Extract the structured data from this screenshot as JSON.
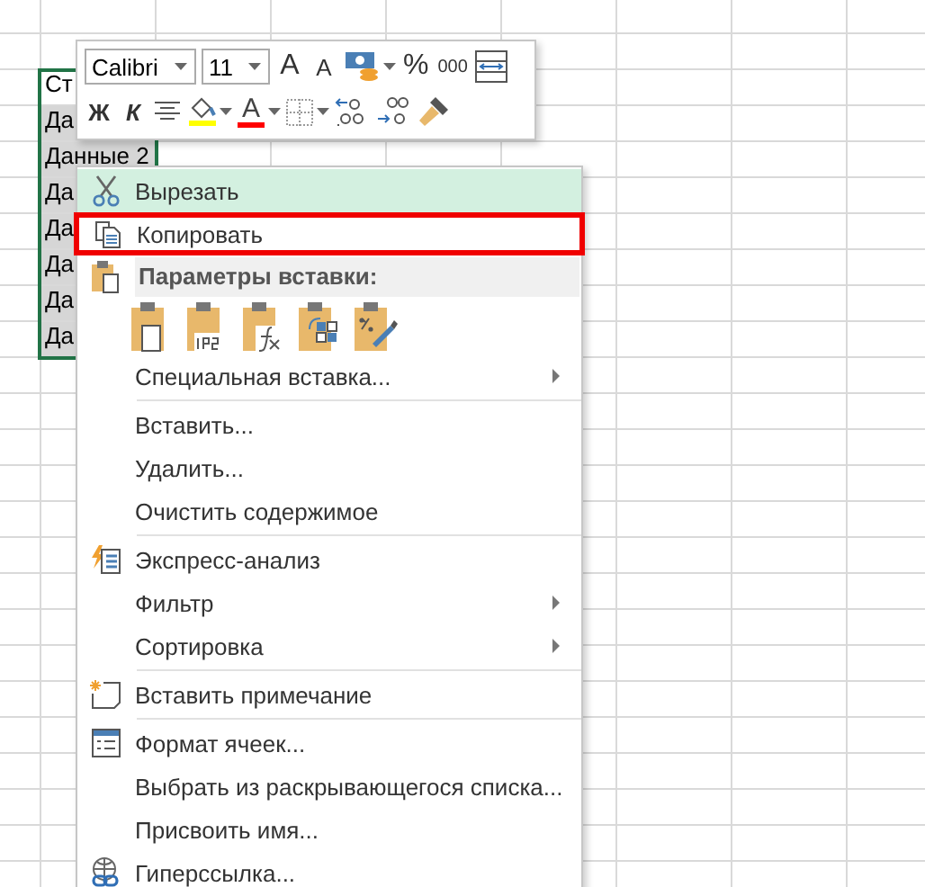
{
  "sheet": {
    "cells": [
      {
        "text": "Ст",
        "selected": false
      },
      {
        "text": "Да",
        "selected": true
      },
      {
        "text": "Данные 2",
        "selected": true
      },
      {
        "text": "Да",
        "selected": true
      },
      {
        "text": "Да",
        "selected": true
      },
      {
        "text": "Да",
        "selected": true
      },
      {
        "text": "Да",
        "selected": true
      },
      {
        "text": "Да",
        "selected": true
      }
    ]
  },
  "mini_toolbar": {
    "font": "Calibri",
    "size": "11",
    "grow_font": "A",
    "shrink_font": "A",
    "percent": "%",
    "thousands": "000",
    "bold": "Ж",
    "italic": "К",
    "font_color_label": "A"
  },
  "context_menu": {
    "items": [
      {
        "kind": "item",
        "label": "Вырезать",
        "highlighted": true,
        "outlined": false,
        "submenu": false
      },
      {
        "kind": "item",
        "label": "Копировать",
        "highlighted": false,
        "outlined": true,
        "submenu": false
      },
      {
        "kind": "header",
        "label": "Параметры вставки:"
      },
      {
        "kind": "paste_options"
      },
      {
        "kind": "item",
        "label": "Специальная вставка...",
        "highlighted": false,
        "outlined": false,
        "submenu": true
      },
      {
        "kind": "separator"
      },
      {
        "kind": "item",
        "label": "Вставить...",
        "highlighted": false,
        "outlined": false,
        "submenu": false
      },
      {
        "kind": "item",
        "label": "Удалить...",
        "highlighted": false,
        "outlined": false,
        "submenu": false
      },
      {
        "kind": "item",
        "label": "Очистить содержимое",
        "highlighted": false,
        "outlined": false,
        "submenu": false
      },
      {
        "kind": "separator"
      },
      {
        "kind": "item",
        "label": "Экспресс-анализ",
        "highlighted": false,
        "outlined": false,
        "submenu": false
      },
      {
        "kind": "item",
        "label": "Фильтр",
        "highlighted": false,
        "outlined": false,
        "submenu": true
      },
      {
        "kind": "item",
        "label": "Сортировка",
        "highlighted": false,
        "outlined": false,
        "submenu": true
      },
      {
        "kind": "separator"
      },
      {
        "kind": "item",
        "label": "Вставить примечание",
        "highlighted": false,
        "outlined": false,
        "submenu": false
      },
      {
        "kind": "separator"
      },
      {
        "kind": "item",
        "label": "Формат ячеек...",
        "highlighted": false,
        "outlined": false,
        "submenu": false
      },
      {
        "kind": "item",
        "label": "Выбрать из раскрывающегося списка...",
        "highlighted": false,
        "outlined": false,
        "submenu": false
      },
      {
        "kind": "item",
        "label": "Присвоить имя...",
        "highlighted": false,
        "outlined": false,
        "submenu": false
      },
      {
        "kind": "item",
        "label": "Гиперссылка...",
        "highlighted": false,
        "outlined": false,
        "submenu": false
      }
    ]
  }
}
